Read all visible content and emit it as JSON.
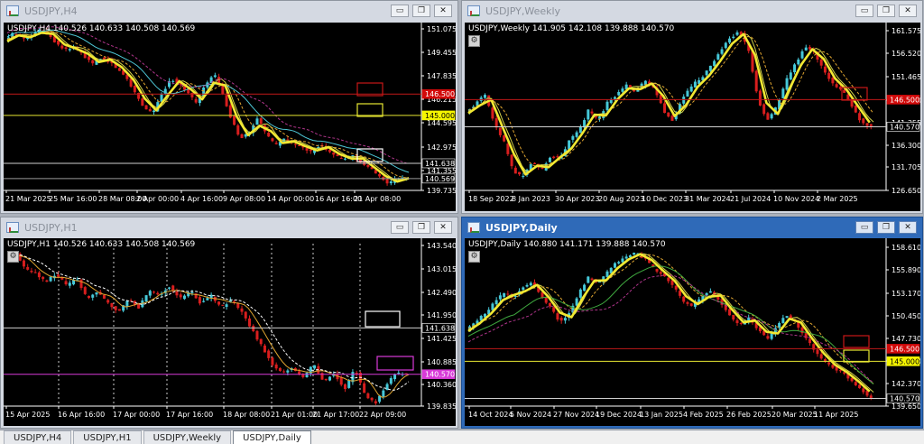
{
  "windows": {
    "h4": {
      "title": "USDJPY,H4",
      "header": "USDJPY,H4  140.526 140.633 140.508 140.569",
      "prices": [
        "151.075",
        "149.455",
        "147.835",
        "146.215",
        "144.595",
        "142.975",
        "141.355",
        "139.735"
      ],
      "dates": [
        "21 Mar 2025",
        "25 Mar 16:00",
        "28 Mar 08:00",
        "2 Apr 00:00",
        "4 Apr 16:00",
        "9 Apr 08:00",
        "14 Apr 00:00",
        "16 Apr 16:00",
        "21 Apr 08:00"
      ],
      "tags": {
        "red": "146.500",
        "yellow": "145.000",
        "white": "141.638",
        "current": "140.569"
      }
    },
    "weekly": {
      "title": "USDJPY,Weekly",
      "header": "USDJPY,Weekly  141.905 142.108 139.888 140.570",
      "prices": [
        "161.575",
        "156.520",
        "151.465",
        "146.410",
        "141.355",
        "136.300",
        "131.705",
        "126.650"
      ],
      "dates": [
        "18 Sep 2022",
        "8 Jan 2023",
        "30 Apr 2023",
        "20 Aug 2023",
        "10 Dec 2023",
        "31 Mar 2024",
        "21 Jul 2024",
        "10 Nov 2024",
        "2 Mar 2025"
      ],
      "tags": {
        "red": "146.500",
        "current": "140.570"
      }
    },
    "h1": {
      "title": "USDJPY,H1",
      "header": "USDJPY,H1  140.526 140.633 140.508 140.569",
      "prices": [
        "143.540",
        "143.015",
        "142.490",
        "141.950",
        "141.425",
        "140.885",
        "140.360",
        "139.835"
      ],
      "dates": [
        "15 Apr 2025",
        "16 Apr 16:00",
        "17 Apr 00:00",
        "17 Apr 16:00",
        "18 Apr 08:00",
        "21 Apr 01:00",
        "21 Apr 17:00",
        "22 Apr 09:00"
      ],
      "tags": {
        "white": "141.638",
        "magenta": "140.570"
      }
    },
    "daily": {
      "title": "USDJPY,Daily",
      "header": "USDJPY,Daily  140.880 141.171 139.888 140.570",
      "prices": [
        "158.610",
        "155.890",
        "153.170",
        "150.450",
        "147.730",
        "145.000",
        "142.370",
        "139.650"
      ],
      "dates": [
        "14 Oct 2024",
        "5 Nov 2024",
        "27 Nov 2024",
        "19 Dec 2024",
        "13 Jan 2025",
        "4 Feb 2025",
        "26 Feb 2025",
        "20 Mar 2025",
        "11 Apr 2025"
      ],
      "tags": {
        "red": "146.500",
        "yellow": "145.000",
        "current": "140.570"
      }
    }
  },
  "window_buttons": {
    "minimize": "▭",
    "restore": "❐",
    "close": "✕"
  },
  "tabs": [
    "USDJPY,H4",
    "USDJPY,H1",
    "USDJPY,Weekly",
    "USDJPY,Daily"
  ],
  "active_tab": "USDJPY,Daily",
  "chart_data": [
    {
      "type": "candlestick",
      "title": "USDJPY,H4",
      "ylim": [
        139.735,
        151.075
      ],
      "horizontal_levels": [
        146.5,
        145.0,
        141.638,
        140.569
      ],
      "close_path": [
        150.2,
        150.8,
        150.4,
        150.6,
        151.0,
        150.7,
        150.0,
        149.6,
        149.8,
        149.2,
        148.6,
        149.0,
        148.8,
        148.2,
        147.6,
        146.5,
        145.5,
        145.2,
        146.5,
        147.6,
        147.2,
        146.6,
        145.8,
        147.2,
        147.9,
        146.4,
        144.6,
        143.4,
        143.8,
        144.8,
        143.6,
        142.9,
        143.3,
        143.0,
        142.8,
        142.4,
        142.9,
        142.6,
        142.1,
        141.9,
        142.2,
        141.6,
        141.2,
        140.7,
        140.2,
        140.6,
        140.57
      ]
    },
    {
      "type": "candlestick",
      "title": "USDJPY,Weekly",
      "ylim": [
        126.65,
        161.575
      ],
      "horizontal_levels": [
        146.5,
        140.57
      ],
      "close_path": [
        143.5,
        145.6,
        147.8,
        141.2,
        137.5,
        131.0,
        129.5,
        133.0,
        130.8,
        134.2,
        133.5,
        137.8,
        139.6,
        144.2,
        141.8,
        145.8,
        147.6,
        149.8,
        148.2,
        150.6,
        148.8,
        144.0,
        141.8,
        146.9,
        149.6,
        151.3,
        153.8,
        157.2,
        159.8,
        161.6,
        157.3,
        146.5,
        142.0,
        145.0,
        150.8,
        154.4,
        158.2,
        156.8,
        152.6,
        149.8,
        148.4,
        144.9,
        141.5,
        140.57
      ]
    },
    {
      "type": "candlestick",
      "title": "USDJPY,H1",
      "ylim": [
        139.835,
        143.54
      ],
      "horizontal_levels": [
        141.638,
        140.57
      ],
      "close_path": [
        143.2,
        143.4,
        143.0,
        142.9,
        142.7,
        142.9,
        142.6,
        142.8,
        142.3,
        142.5,
        142.2,
        142.0,
        142.3,
        142.1,
        142.5,
        142.4,
        142.6,
        142.3,
        142.5,
        142.2,
        142.4,
        142.1,
        142.3,
        142.0,
        141.6,
        141.2,
        140.8,
        140.6,
        140.7,
        140.5,
        140.8,
        140.4,
        140.6,
        140.2,
        140.7,
        140.1,
        139.9,
        140.3,
        140.6,
        140.57
      ]
    },
    {
      "type": "candlestick",
      "title": "USDJPY,Daily",
      "ylim": [
        139.65,
        158.61
      ],
      "horizontal_levels": [
        146.5,
        145.0,
        140.57
      ],
      "close_path": [
        148.6,
        149.8,
        150.6,
        152.0,
        153.2,
        152.6,
        153.8,
        154.4,
        152.8,
        151.4,
        149.6,
        150.8,
        153.2,
        155.0,
        154.2,
        155.6,
        156.8,
        157.4,
        158.0,
        157.2,
        156.0,
        155.2,
        154.0,
        152.2,
        151.6,
        152.6,
        153.4,
        152.0,
        150.6,
        149.2,
        150.2,
        148.8,
        147.6,
        149.2,
        150.6,
        149.6,
        147.8,
        146.4,
        145.0,
        144.2,
        143.6,
        142.6,
        141.6,
        140.57
      ]
    }
  ]
}
